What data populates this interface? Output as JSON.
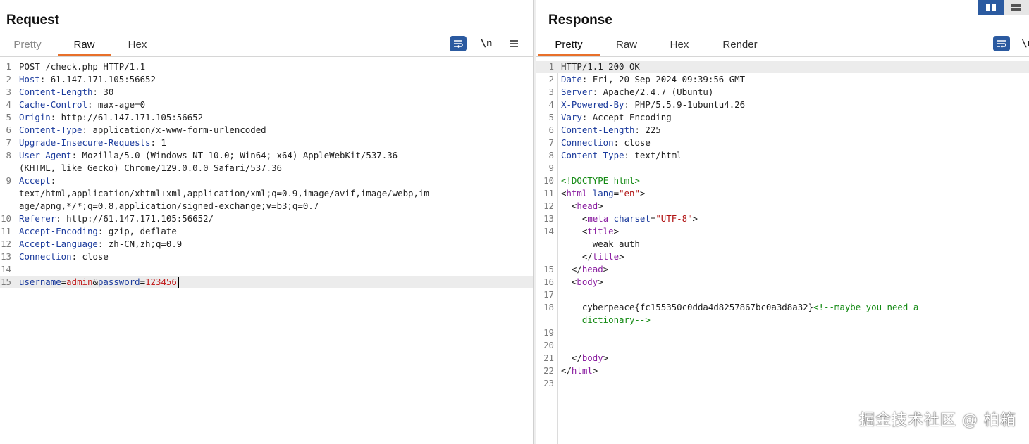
{
  "request": {
    "title": "Request",
    "tabs": [
      "Pretty",
      "Raw",
      "Hex"
    ],
    "active_tab": "Raw",
    "newline_toggle": "\\n",
    "icons": [
      "wrap-icon",
      "newline-icon",
      "menu-icon"
    ],
    "lines": [
      {
        "n": "1",
        "parts": [
          {
            "c": "v",
            "t": "POST /check.php HTTP/1.1"
          }
        ]
      },
      {
        "n": "2",
        "parts": [
          {
            "c": "k",
            "t": "Host"
          },
          {
            "c": "v",
            "t": ": 61.147.171.105:56652"
          }
        ]
      },
      {
        "n": "3",
        "parts": [
          {
            "c": "k",
            "t": "Content-Length"
          },
          {
            "c": "v",
            "t": ": 30"
          }
        ]
      },
      {
        "n": "4",
        "parts": [
          {
            "c": "k",
            "t": "Cache-Control"
          },
          {
            "c": "v",
            "t": ": max-age=0"
          }
        ]
      },
      {
        "n": "5",
        "parts": [
          {
            "c": "k",
            "t": "Origin"
          },
          {
            "c": "v",
            "t": ": http://61.147.171.105:56652"
          }
        ]
      },
      {
        "n": "6",
        "parts": [
          {
            "c": "k",
            "t": "Content-Type"
          },
          {
            "c": "v",
            "t": ": application/x-www-form-urlencoded"
          }
        ]
      },
      {
        "n": "7",
        "parts": [
          {
            "c": "k",
            "t": "Upgrade-Insecure-Requests"
          },
          {
            "c": "v",
            "t": ": 1"
          }
        ]
      },
      {
        "n": "8",
        "parts": [
          {
            "c": "k",
            "t": "User-Agent"
          },
          {
            "c": "v",
            "t": ": Mozilla/5.0 (Windows NT 10.0; Win64; x64) AppleWebKit/537.36"
          }
        ]
      },
      {
        "n": "",
        "parts": [
          {
            "c": "v",
            "t": "(KHTML, like Gecko) Chrome/129.0.0.0 Safari/537.36"
          }
        ]
      },
      {
        "n": "9",
        "parts": [
          {
            "c": "k",
            "t": "Accept"
          },
          {
            "c": "v",
            "t": ":"
          }
        ]
      },
      {
        "n": "",
        "parts": [
          {
            "c": "v",
            "t": "text/html,application/xhtml+xml,application/xml;q=0.9,image/avif,image/webp,im"
          }
        ]
      },
      {
        "n": "",
        "parts": [
          {
            "c": "v",
            "t": "age/apng,*/*;q=0.8,application/signed-exchange;v=b3;q=0.7"
          }
        ]
      },
      {
        "n": "10",
        "parts": [
          {
            "c": "k",
            "t": "Referer"
          },
          {
            "c": "v",
            "t": ": http://61.147.171.105:56652/"
          }
        ]
      },
      {
        "n": "11",
        "parts": [
          {
            "c": "k",
            "t": "Accept-Encoding"
          },
          {
            "c": "v",
            "t": ": gzip, deflate"
          }
        ]
      },
      {
        "n": "12",
        "parts": [
          {
            "c": "k",
            "t": "Accept-Language"
          },
          {
            "c": "v",
            "t": ": zh-CN,zh;q=0.9"
          }
        ]
      },
      {
        "n": "13",
        "parts": [
          {
            "c": "k",
            "t": "Connection"
          },
          {
            "c": "v",
            "t": ": close"
          }
        ]
      },
      {
        "n": "14",
        "parts": []
      },
      {
        "n": "15",
        "hl": true,
        "cursor": true,
        "parts": [
          {
            "c": "pk",
            "t": "username"
          },
          {
            "c": "pun",
            "t": "="
          },
          {
            "c": "pv",
            "t": "admin"
          },
          {
            "c": "pun",
            "t": "&"
          },
          {
            "c": "pk",
            "t": "password"
          },
          {
            "c": "pun",
            "t": "="
          },
          {
            "c": "pv",
            "t": "123456"
          }
        ]
      }
    ]
  },
  "response": {
    "title": "Response",
    "tabs": [
      "Pretty",
      "Raw",
      "Hex",
      "Render"
    ],
    "active_tab": "Pretty",
    "icons": [
      "wrap-icon",
      "newline-icon"
    ],
    "lines": [
      {
        "n": "1",
        "hl": true,
        "parts": [
          {
            "c": "v",
            "t": "HTTP/1.1 200 OK"
          }
        ]
      },
      {
        "n": "2",
        "parts": [
          {
            "c": "k",
            "t": "Date"
          },
          {
            "c": "v",
            "t": ": Fri, 20 Sep 2024 09:39:56 GMT"
          }
        ]
      },
      {
        "n": "3",
        "parts": [
          {
            "c": "k",
            "t": "Server"
          },
          {
            "c": "v",
            "t": ": Apache/2.4.7 (Ubuntu)"
          }
        ]
      },
      {
        "n": "4",
        "parts": [
          {
            "c": "k",
            "t": "X-Powered-By"
          },
          {
            "c": "v",
            "t": ": PHP/5.5.9-1ubuntu4.26"
          }
        ]
      },
      {
        "n": "5",
        "parts": [
          {
            "c": "k",
            "t": "Vary"
          },
          {
            "c": "v",
            "t": ": Accept-Encoding"
          }
        ]
      },
      {
        "n": "6",
        "parts": [
          {
            "c": "k",
            "t": "Content-Length"
          },
          {
            "c": "v",
            "t": ": 225"
          }
        ]
      },
      {
        "n": "7",
        "parts": [
          {
            "c": "k",
            "t": "Connection"
          },
          {
            "c": "v",
            "t": ": close"
          }
        ]
      },
      {
        "n": "8",
        "parts": [
          {
            "c": "k",
            "t": "Content-Type"
          },
          {
            "c": "v",
            "t": ": text/html"
          }
        ]
      },
      {
        "n": "9",
        "parts": []
      },
      {
        "n": "10",
        "parts": [
          {
            "c": "cm",
            "t": "<!DOCTYPE html>"
          }
        ]
      },
      {
        "n": "11",
        "parts": [
          {
            "c": "pun",
            "t": "<"
          },
          {
            "c": "tg",
            "t": "html"
          },
          {
            "c": "at",
            "t": " lang"
          },
          {
            "c": "pun",
            "t": "="
          },
          {
            "c": "av",
            "t": "\"en\""
          },
          {
            "c": "pun",
            "t": ">"
          }
        ]
      },
      {
        "n": "12",
        "parts": [
          {
            "c": "pun",
            "t": "  <"
          },
          {
            "c": "tg",
            "t": "head"
          },
          {
            "c": "pun",
            "t": ">"
          }
        ]
      },
      {
        "n": "13",
        "parts": [
          {
            "c": "pun",
            "t": "    <"
          },
          {
            "c": "tg",
            "t": "meta"
          },
          {
            "c": "at",
            "t": " charset"
          },
          {
            "c": "pun",
            "t": "="
          },
          {
            "c": "av",
            "t": "\"UTF-8\""
          },
          {
            "c": "pun",
            "t": ">"
          }
        ]
      },
      {
        "n": "14",
        "parts": [
          {
            "c": "pun",
            "t": "    <"
          },
          {
            "c": "tg",
            "t": "title"
          },
          {
            "c": "pun",
            "t": ">"
          }
        ]
      },
      {
        "n": "",
        "parts": [
          {
            "c": "v",
            "t": "      weak auth"
          }
        ]
      },
      {
        "n": "",
        "parts": [
          {
            "c": "pun",
            "t": "    </"
          },
          {
            "c": "tg",
            "t": "title"
          },
          {
            "c": "pun",
            "t": ">"
          }
        ]
      },
      {
        "n": "15",
        "parts": [
          {
            "c": "pun",
            "t": "  </"
          },
          {
            "c": "tg",
            "t": "head"
          },
          {
            "c": "pun",
            "t": ">"
          }
        ]
      },
      {
        "n": "16",
        "parts": [
          {
            "c": "pun",
            "t": "  <"
          },
          {
            "c": "tg",
            "t": "body"
          },
          {
            "c": "pun",
            "t": ">"
          }
        ]
      },
      {
        "n": "17",
        "parts": []
      },
      {
        "n": "18",
        "parts": [
          {
            "c": "v",
            "t": "    cyberpeace{fc155350c0dda4d8257867bc0a3d8a32}"
          },
          {
            "c": "cm",
            "t": "<!--maybe you need a"
          }
        ]
      },
      {
        "n": "",
        "parts": [
          {
            "c": "cm",
            "t": "    dictionary-->"
          }
        ]
      },
      {
        "n": "19",
        "parts": []
      },
      {
        "n": "20",
        "parts": []
      },
      {
        "n": "21",
        "parts": [
          {
            "c": "pun",
            "t": "  </"
          },
          {
            "c": "tg",
            "t": "body"
          },
          {
            "c": "pun",
            "t": ">"
          }
        ]
      },
      {
        "n": "22",
        "parts": [
          {
            "c": "pun",
            "t": "</"
          },
          {
            "c": "tg",
            "t": "html"
          },
          {
            "c": "pun",
            "t": ">"
          }
        ]
      },
      {
        "n": "23",
        "parts": []
      }
    ]
  },
  "layout_toggle_icons": [
    "split-view-icon",
    "stacked-view-icon"
  ],
  "watermark": "掘金技术社区 @ 柏箱",
  "colors": {
    "accent_tab": "#e8702a",
    "button_blue": "#2b5aa0"
  }
}
